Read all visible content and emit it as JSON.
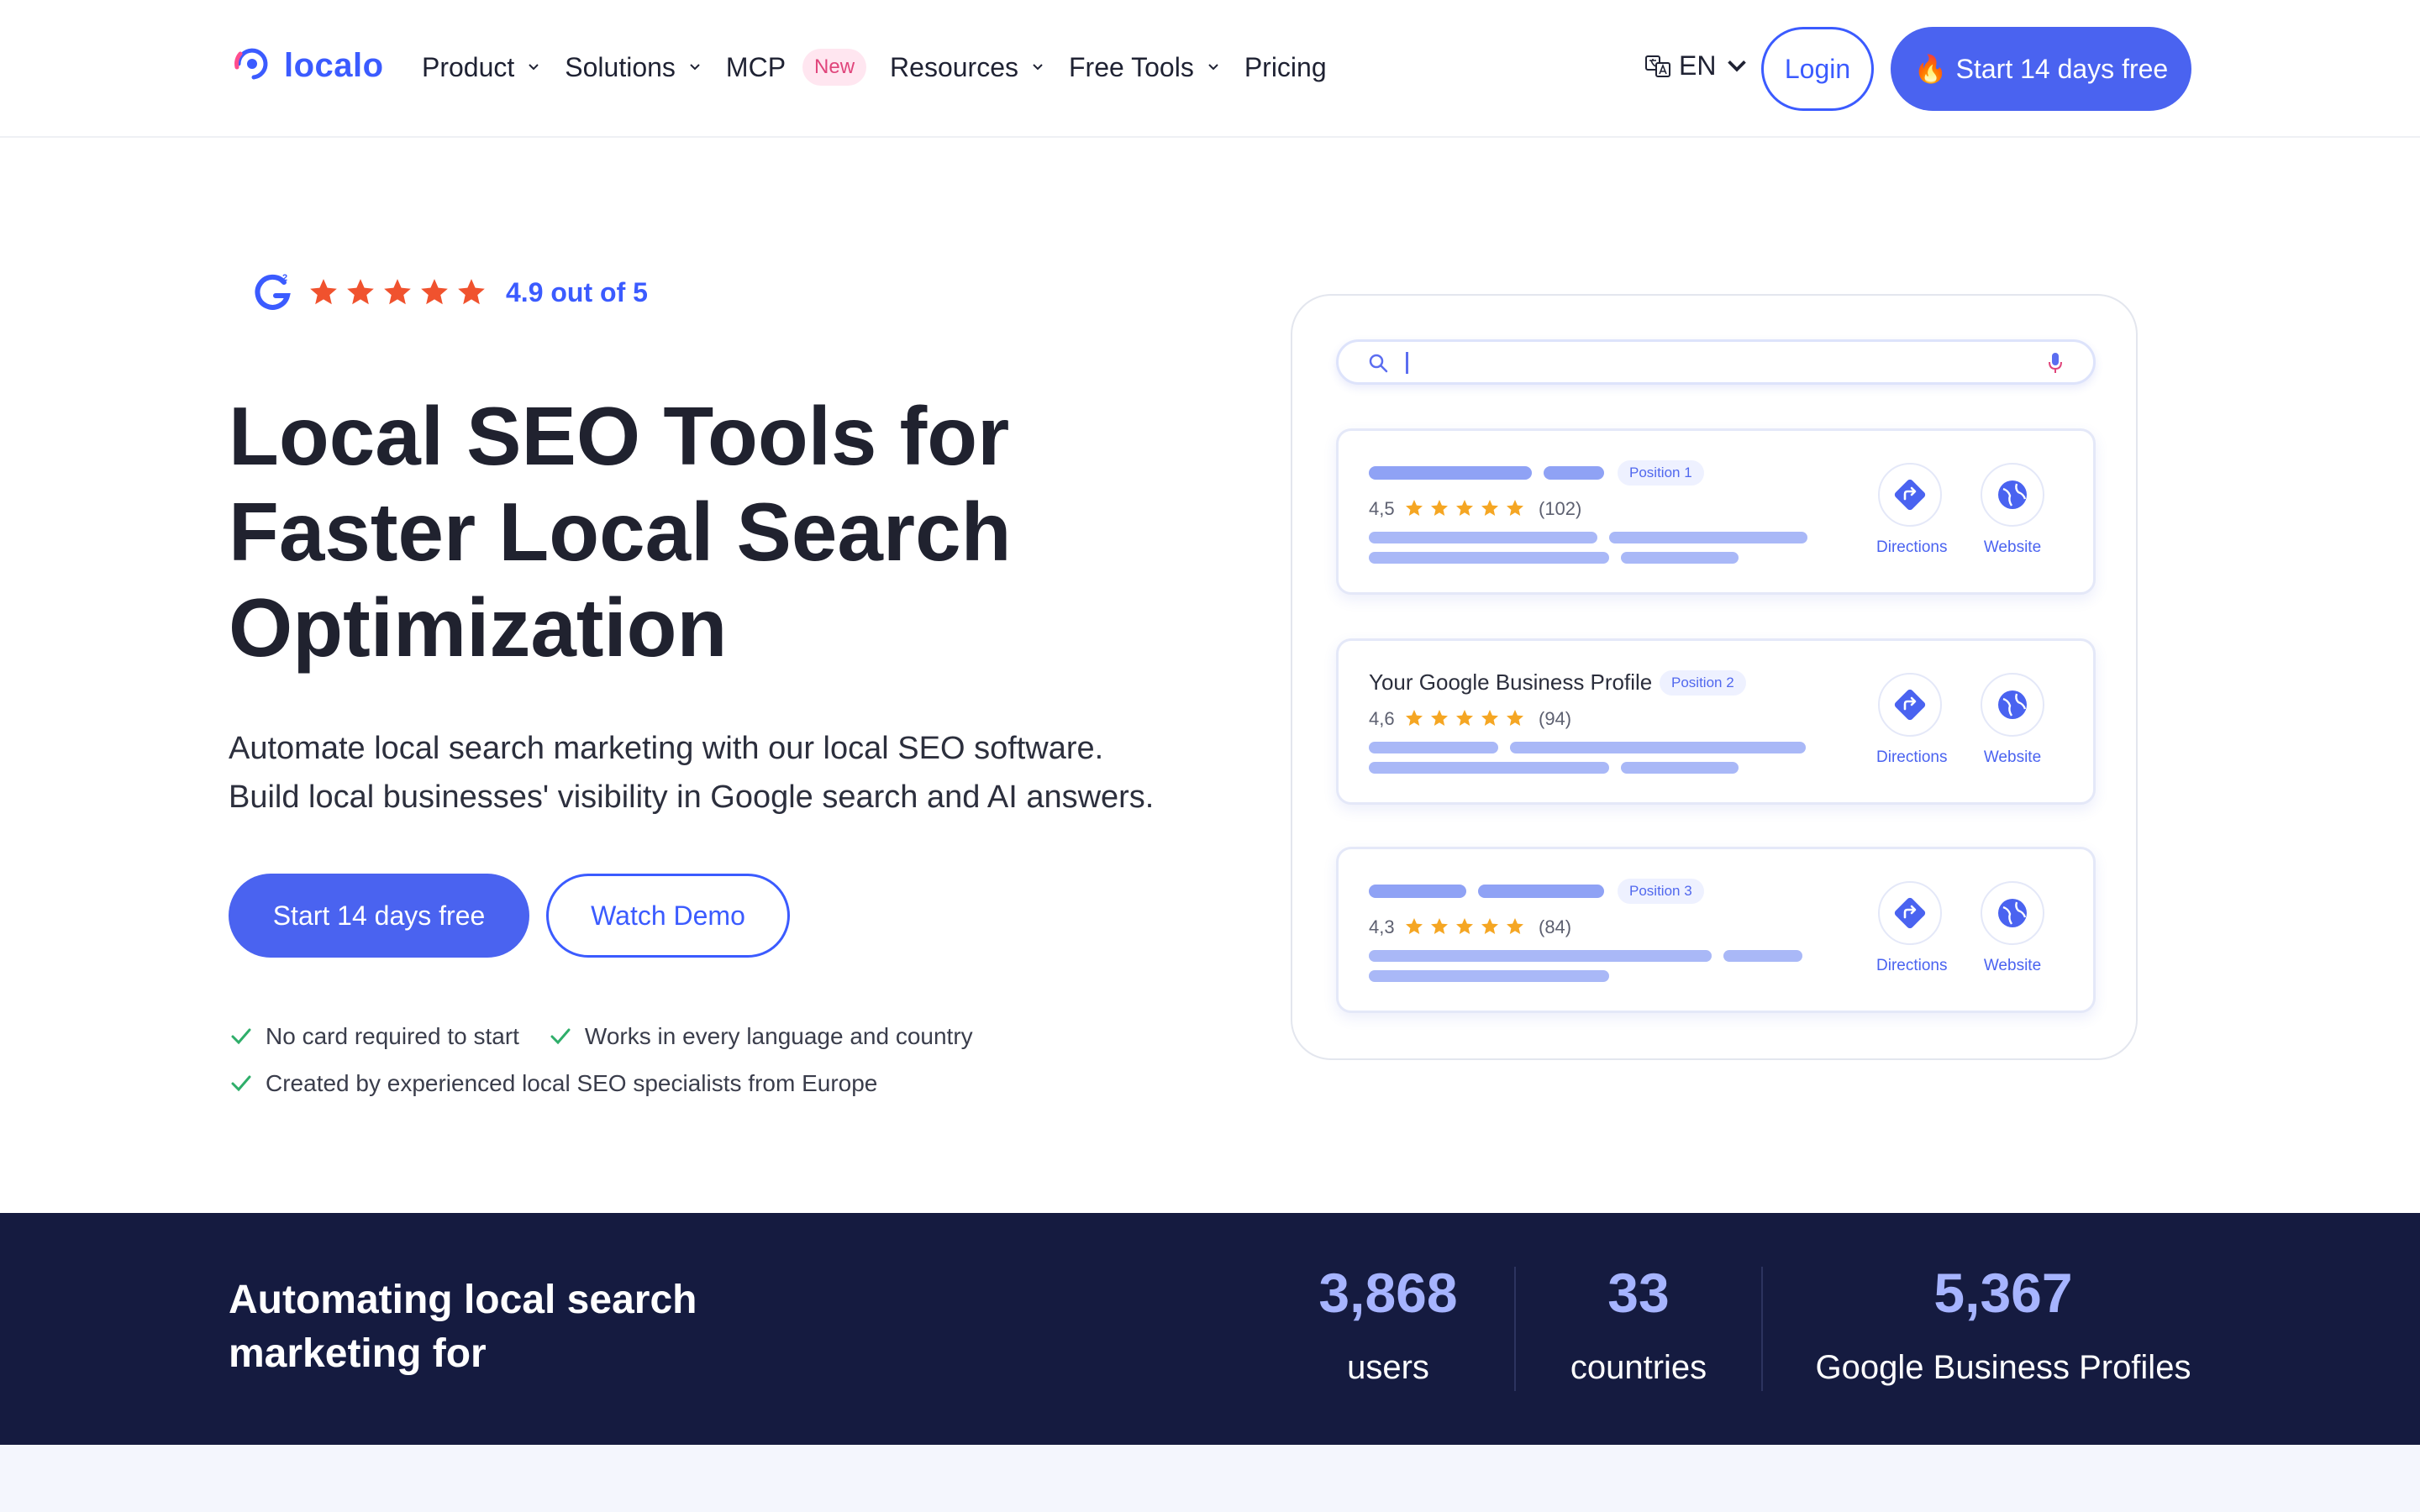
{
  "header": {
    "logo_text": "localo",
    "nav": [
      {
        "label": "Product",
        "dropdown": true
      },
      {
        "label": "Solutions",
        "dropdown": true
      },
      {
        "label": "MCP",
        "dropdown": false,
        "badge": "New"
      },
      {
        "label": "Resources",
        "dropdown": true
      },
      {
        "label": "Free Tools",
        "dropdown": true
      },
      {
        "label": "Pricing",
        "dropdown": false
      }
    ],
    "language": "EN",
    "login_label": "Login",
    "cta_emoji": "🔥",
    "cta_label": "Start 14 days free"
  },
  "hero": {
    "rating": {
      "score_text": "4.9 out of 5",
      "stars": 5,
      "source_icon": "g2-logo"
    },
    "title_lines": [
      "Local SEO Tools for",
      "Faster Local Search",
      "Optimization"
    ],
    "subtitle_lines": [
      "Automate local search marketing with our local SEO software.",
      "Build local businesses' visibility in Google search and AI answers."
    ],
    "primary_cta": "Start 14 days free",
    "secondary_cta": "Watch Demo",
    "checks": [
      "No card required to start",
      "Works in every language and country",
      "Created by experienced local SEO specialists from Europe"
    ]
  },
  "mockup": {
    "search_placeholder": "",
    "results": [
      {
        "name": "",
        "position": "Position 1",
        "rating": "4,5",
        "count": "(102)",
        "directions": "Directions",
        "website": "Website"
      },
      {
        "name": "Your Google Business Profile",
        "position": "Position 2",
        "rating": "4,6",
        "count": "(94)",
        "directions": "Directions",
        "website": "Website"
      },
      {
        "name": "",
        "position": "Position 3",
        "rating": "4,3",
        "count": "(84)",
        "directions": "Directions",
        "website": "Website"
      }
    ]
  },
  "stats": {
    "title_lines": [
      "Automating local search",
      "marketing for"
    ],
    "items": [
      {
        "value": "3,868",
        "label": "users"
      },
      {
        "value": "33",
        "label": "countries"
      },
      {
        "value": "5,367",
        "label": "Google Business Profiles"
      }
    ]
  },
  "colors": {
    "brand": "#4a63f0",
    "star": "#f0522e",
    "mini_star": "#f5a623",
    "stats_bg": "#151b40",
    "stat_number": "#a6b4ff",
    "check": "#2fae6a"
  }
}
